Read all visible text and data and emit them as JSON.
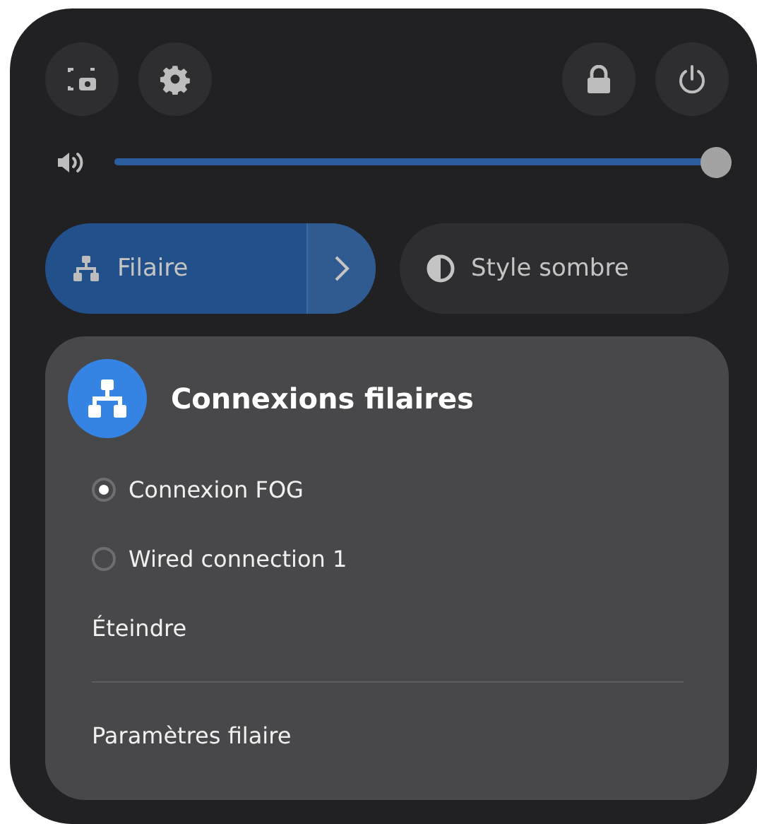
{
  "quick_buttons": [
    {
      "kind": "screenshot"
    },
    {
      "kind": "settings"
    },
    {
      "kind": "lock"
    },
    {
      "kind": "power"
    }
  ],
  "volume": {
    "level": 1.0
  },
  "toggles": [
    {
      "label": "Filaire",
      "kind": "network",
      "on": true,
      "has_menu": true
    },
    {
      "label": "Style sombre",
      "kind": "dark-style",
      "on": false,
      "has_menu": false
    }
  ],
  "menu": {
    "title": "Connexions filaires",
    "connections": [
      {
        "label": "Connexion FOG",
        "selected": true
      },
      {
        "label": "Wired connection 1",
        "selected": false
      }
    ],
    "actions": [
      "Éteindre"
    ],
    "footer": "Paramètres filaire"
  }
}
